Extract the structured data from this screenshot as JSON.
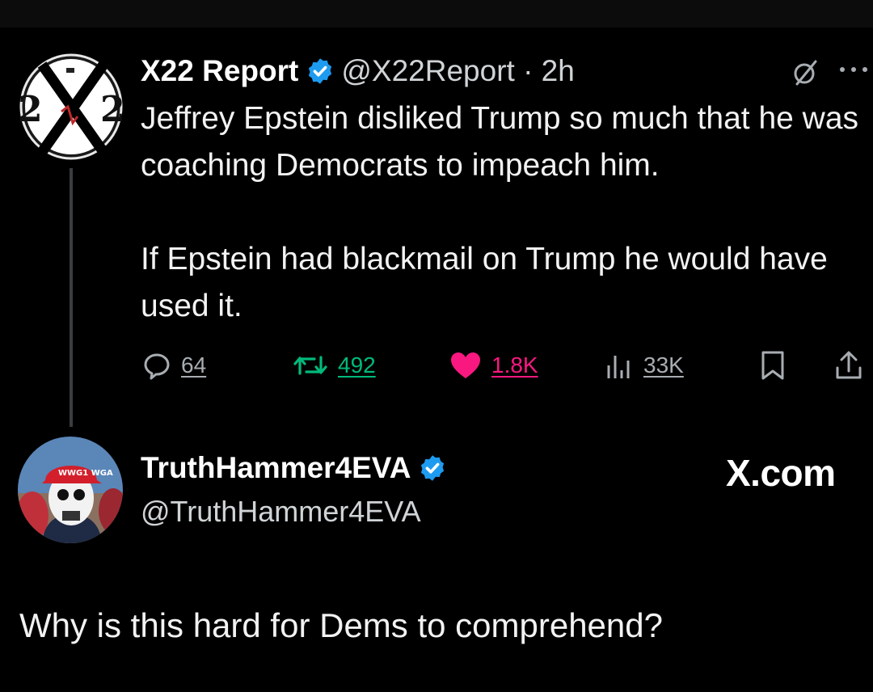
{
  "original_tweet": {
    "author_name": "X22 Report",
    "handle_time": "@X22Report · 2h",
    "avatar_text": "2X2",
    "text_paragraphs": [
      "Jeffrey Epstein disliked Trump so much that he was coaching Democrats to impeach him.",
      "If Epstein had blackmail on Trump he would have used it."
    ],
    "stats": {
      "replies": "64",
      "reposts": "492",
      "likes": "1.8K",
      "views": "33K"
    },
    "icons": [
      "verified-badge-icon",
      "grok-icon",
      "more-icon",
      "reply-icon",
      "repost-icon",
      "like-icon",
      "views-icon",
      "bookmark-icon",
      "share-icon"
    ]
  },
  "reply": {
    "author_name": "TruthHammer4EVA",
    "handle": "@TruthHammer4EVA",
    "brand": "X.com",
    "avatar_hat_text": "WWG1 WGA"
  },
  "caption": "Why is this hard for Dems to comprehend?",
  "colors": {
    "background": "#000000",
    "verified": "#1d9bf0",
    "repost": "#00ba7c",
    "like": "#f91880",
    "muted": "#a8adb2"
  }
}
